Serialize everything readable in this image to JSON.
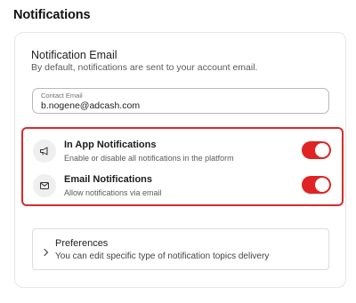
{
  "page": {
    "title": "Notifications"
  },
  "email_section": {
    "title": "Notification Email",
    "description": "By default, notifications are sent to your account email.",
    "contact_field": {
      "label": "Contact Email",
      "value": "b.nogene@adcash.com"
    }
  },
  "notifications": [
    {
      "title": "In App Notifications",
      "description": "Enable or disable all notifications in the platform",
      "icon": "megaphone-icon",
      "enabled": true
    },
    {
      "title": "Email Notifications",
      "description": "Allow notifications via email",
      "icon": "mail-icon",
      "enabled": true
    }
  ],
  "preferences": {
    "title": "Preferences",
    "description": "You can edit specific type of notification topics delivery",
    "icon": "chevron-right-icon"
  },
  "colors": {
    "toggle_on": "#e02424",
    "highlight_border": "#d62c2c"
  }
}
